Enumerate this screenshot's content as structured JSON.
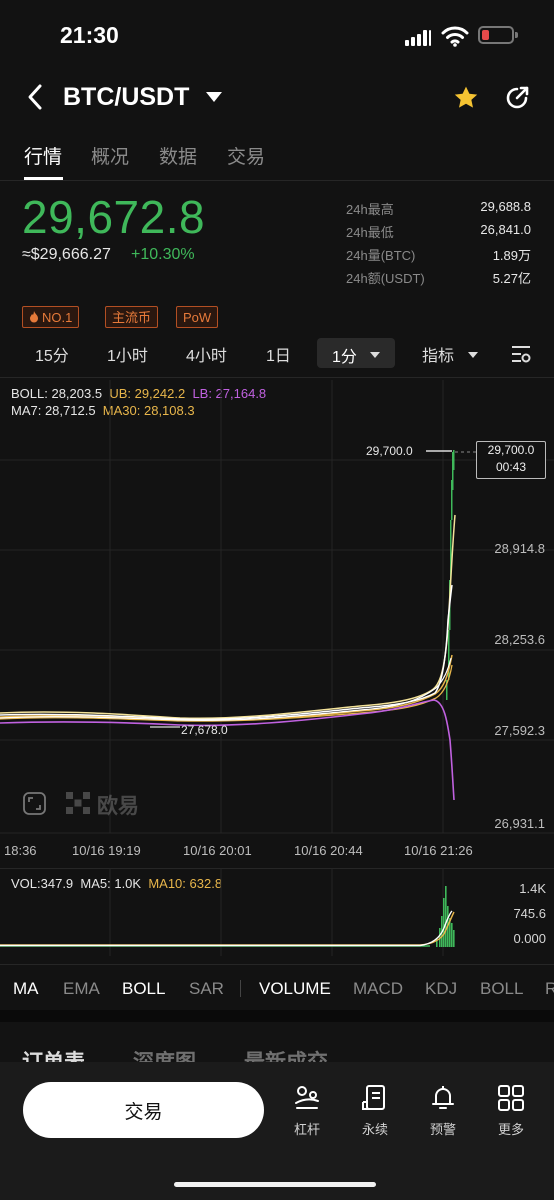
{
  "status_bar": {
    "time": "21:30",
    "battery_color": "#e84a4a"
  },
  "header": {
    "pair": "BTC/USDT",
    "back_icon": "chevron-left-icon",
    "favorite_icon": "star-icon",
    "favorite_color": "#f5c332",
    "share_icon": "share-icon"
  },
  "tabs": [
    {
      "label": "行情",
      "active": true
    },
    {
      "label": "概况",
      "active": false
    },
    {
      "label": "数据",
      "active": false
    },
    {
      "label": "交易",
      "active": false
    }
  ],
  "price": {
    "last": "29,672.8",
    "usd_equiv": "≈$29,666.27",
    "change_pct": "+10.30%",
    "up_color": "#3fb85a"
  },
  "stats": [
    {
      "label": "24h最高",
      "value": "29,688.8"
    },
    {
      "label": "24h最低",
      "value": "26,841.0"
    },
    {
      "label": "24h量(BTC)",
      "value": "1.89万"
    },
    {
      "label": "24h额(USDT)",
      "value": "5.27亿"
    }
  ],
  "tags": [
    {
      "label": "NO.1",
      "icon": "fire-icon"
    },
    {
      "label": "主流币"
    },
    {
      "label": "PoW"
    }
  ],
  "intervals": [
    "15分",
    "1小时",
    "4小时",
    "1日"
  ],
  "interval_selected": "1分",
  "indicator_menu": "指标",
  "indicators": {
    "boll": "BOLL: 28,203.5",
    "ub": "UB: 29,242.2",
    "lb": "LB: 27,164.8",
    "ma7": "MA7: 28,712.5",
    "ma30": "MA30: 28,108.3"
  },
  "chart": {
    "price_axis": [
      "28,914.8",
      "28,253.6",
      "27,592.3",
      "26,931.1"
    ],
    "time_axis": [
      "18:36",
      "10/16 19:19",
      "10/16 20:01",
      "10/16 20:44",
      "10/16 21:26"
    ],
    "high_marker": "29,700.0",
    "low_marker": "27,678.0",
    "last_box_price": "29,700.0",
    "last_box_countdown": "00:43",
    "watermark": "欧易",
    "colors": {
      "ma7": "#ffffff",
      "ma30": "#e8b64b",
      "boll": "#f4e39a",
      "lb": "#c061e0",
      "up": "#3fb85a"
    }
  },
  "chart_data": {
    "type": "line",
    "ylim": [
      26931.1,
      29700.0
    ],
    "x": [
      "18:36",
      "10/16 19:19",
      "10/16 20:01",
      "10/16 20:44",
      "10/16 21:26"
    ],
    "series": [
      {
        "name": "MA7",
        "values": [
          27660,
          27640,
          27680,
          27720,
          29000
        ]
      },
      {
        "name": "MA30",
        "values": [
          27670,
          27650,
          27690,
          27740,
          28750
        ]
      },
      {
        "name": "UB",
        "values": [
          27690,
          27670,
          27700,
          27760,
          29242.2
        ]
      },
      {
        "name": "LB",
        "values": [
          27610,
          27620,
          27660,
          27700,
          27164.8
        ]
      }
    ]
  },
  "volume": {
    "vol": "VOL:347.9",
    "ma5": "MA5: 1.0K",
    "ma10": "MA10: 632.8",
    "axis": [
      "1.4K",
      "745.6",
      "0.000"
    ]
  },
  "indicator_tabs": [
    {
      "label": "MA",
      "on": true
    },
    {
      "label": "EMA",
      "on": false
    },
    {
      "label": "BOLL",
      "on": true
    },
    {
      "label": "SAR",
      "on": false
    },
    {
      "label": "VOLUME",
      "on": true
    },
    {
      "label": "MACD",
      "on": false
    },
    {
      "label": "KDJ",
      "on": false
    },
    {
      "label": "BOLL",
      "on": false
    },
    {
      "label": "R",
      "on": false
    }
  ],
  "panel_tabs": [
    {
      "label": "订单表",
      "on": true
    },
    {
      "label": "深度图",
      "on": false
    },
    {
      "label": "最新成交",
      "on": false
    }
  ],
  "bottom_nav": {
    "trade": "交易",
    "items": [
      {
        "label": "杠杆",
        "icon": "leverage-icon"
      },
      {
        "label": "永续",
        "icon": "perpetual-icon"
      },
      {
        "label": "预警",
        "icon": "bell-icon"
      },
      {
        "label": "更多",
        "icon": "grid-icon"
      }
    ]
  }
}
